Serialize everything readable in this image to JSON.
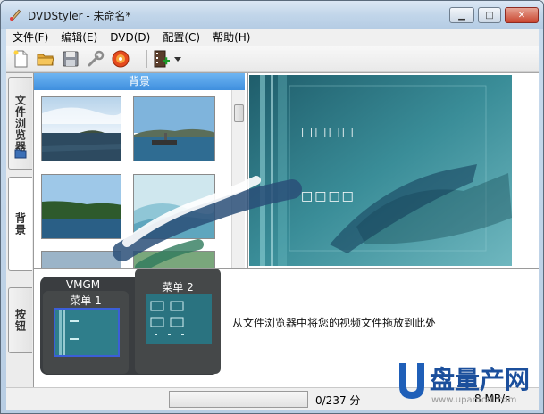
{
  "window": {
    "title": "DVDStyler - 未命名*"
  },
  "menubar": {
    "items": [
      {
        "label": "文件(F)"
      },
      {
        "label": "编辑(E)"
      },
      {
        "label": "DVD(D)"
      },
      {
        "label": "配置(C)"
      },
      {
        "label": "帮助(H)"
      }
    ]
  },
  "toolbar": {
    "icons": [
      "new-file-icon",
      "open-folder-icon",
      "save-icon",
      "settings-wrench-icon",
      "burn-disc-icon",
      "add-title-icon",
      "dropdown-arrow-icon"
    ]
  },
  "sidebar": {
    "tabs": [
      {
        "label": "文件浏览器"
      },
      {
        "label": "背景"
      },
      {
        "label": "按钮"
      }
    ]
  },
  "browser": {
    "header": "背景"
  },
  "preview": {
    "placeholder_top": "□□□□",
    "placeholder_bottom": "□□□□"
  },
  "menus": {
    "vmgm_label": "VMGM",
    "items": [
      {
        "label": "菜单 1"
      },
      {
        "label": "菜单 2"
      }
    ],
    "drop_hint": "从文件浏览器中将您的视频文件拖放到此处"
  },
  "statusbar": {
    "progress_text": "0/237 分",
    "size_text": "8 MB/s"
  },
  "watermark": {
    "text_main": "盘量产网",
    "text_url": "www.upantool.com"
  },
  "colors": {
    "accent": "#3f8fde",
    "preview_bg": "#2e7d86",
    "menu_dark": "#3a3d40"
  }
}
